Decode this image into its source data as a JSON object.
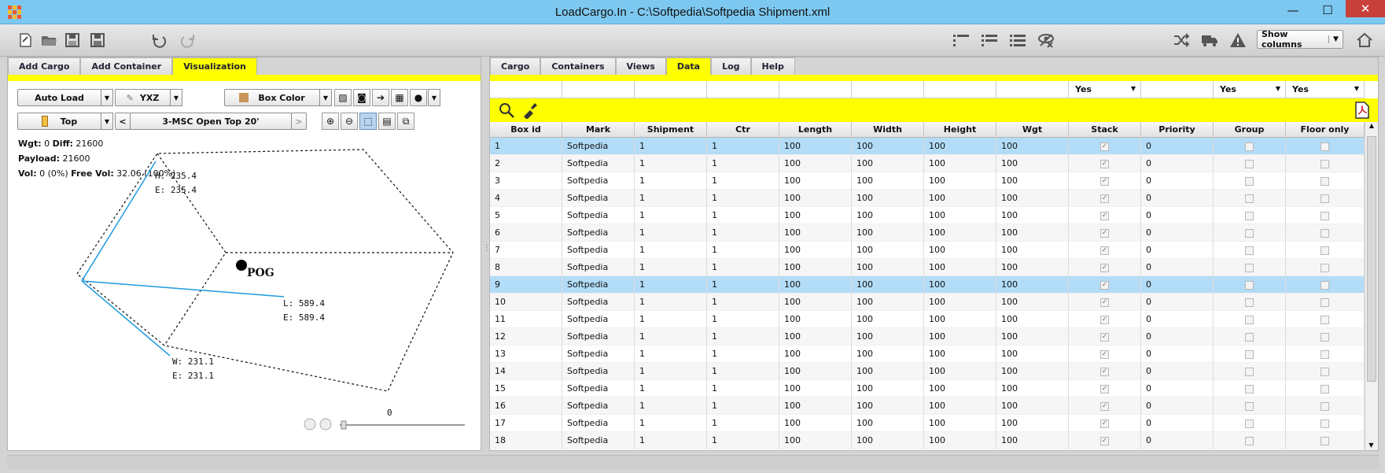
{
  "window": {
    "title": "LoadCargo.In - C:\\Softpedia\\Softpedia Shipment.xml",
    "min": "—",
    "max": "☐",
    "close": "✕"
  },
  "toolbar": {
    "show_columns_label": "Show columns",
    "show_columns_caret": "▼"
  },
  "left": {
    "tabs": [
      {
        "label": "Add Cargo",
        "active": false
      },
      {
        "label": "Add Container",
        "active": false
      },
      {
        "label": "Visualization",
        "active": true
      }
    ],
    "auto_load": "Auto Load",
    "axis_order": "YXZ",
    "box_color": "Box Color",
    "view": "Top",
    "prev": "<",
    "next": ">",
    "container": "3-MSC Open Top 20'",
    "stats": {
      "wgt_label": "Wgt:",
      "wgt": "0",
      "diff_label": "Diff:",
      "diff": "21600",
      "payload_label": "Payload:",
      "payload": "21600",
      "vol_label": "Vol:",
      "vol": "0 (0%)",
      "free_vol_label": "Free Vol:",
      "free_vol": "32.06 (100%)"
    },
    "measures": {
      "h": "H: 235.4",
      "h_e": "E: 235.4",
      "l": "L: 589.4",
      "l_e": "E: 589.4",
      "w": "W: 231.1",
      "w_e": "E: 231.1"
    },
    "pog": "POG",
    "slider_value": "0"
  },
  "right": {
    "tabs": [
      {
        "label": "Cargo",
        "active": false
      },
      {
        "label": "Containers",
        "active": false
      },
      {
        "label": "Views",
        "active": false
      },
      {
        "label": "Data",
        "active": true
      },
      {
        "label": "Log",
        "active": false
      },
      {
        "label": "Help",
        "active": false
      }
    ],
    "filters": [
      "",
      "",
      "",
      "",
      "",
      "",
      "",
      "",
      "Yes",
      "",
      "Yes",
      "Yes"
    ],
    "columns": [
      "Box id",
      "Mark",
      "Shipment",
      "Ctr",
      "Length",
      "Width",
      "Height",
      "Wgt",
      "Stack",
      "Priority",
      "Group",
      "Floor only"
    ],
    "rows": [
      {
        "id": "1",
        "mark": "Softpedia",
        "shipment": "1",
        "ctr": "1",
        "length": "100",
        "width": "100",
        "height": "100",
        "wgt": "100",
        "stack": true,
        "priority": "0",
        "group": false,
        "floor": false
      },
      {
        "id": "2",
        "mark": "Softpedia",
        "shipment": "1",
        "ctr": "1",
        "length": "100",
        "width": "100",
        "height": "100",
        "wgt": "100",
        "stack": true,
        "priority": "0",
        "group": false,
        "floor": false
      },
      {
        "id": "3",
        "mark": "Softpedia",
        "shipment": "1",
        "ctr": "1",
        "length": "100",
        "width": "100",
        "height": "100",
        "wgt": "100",
        "stack": true,
        "priority": "0",
        "group": false,
        "floor": false
      },
      {
        "id": "4",
        "mark": "Softpedia",
        "shipment": "1",
        "ctr": "1",
        "length": "100",
        "width": "100",
        "height": "100",
        "wgt": "100",
        "stack": true,
        "priority": "0",
        "group": false,
        "floor": false
      },
      {
        "id": "5",
        "mark": "Softpedia",
        "shipment": "1",
        "ctr": "1",
        "length": "100",
        "width": "100",
        "height": "100",
        "wgt": "100",
        "stack": true,
        "priority": "0",
        "group": false,
        "floor": false
      },
      {
        "id": "6",
        "mark": "Softpedia",
        "shipment": "1",
        "ctr": "1",
        "length": "100",
        "width": "100",
        "height": "100",
        "wgt": "100",
        "stack": true,
        "priority": "0",
        "group": false,
        "floor": false
      },
      {
        "id": "7",
        "mark": "Softpedia",
        "shipment": "1",
        "ctr": "1",
        "length": "100",
        "width": "100",
        "height": "100",
        "wgt": "100",
        "stack": true,
        "priority": "0",
        "group": false,
        "floor": false
      },
      {
        "id": "8",
        "mark": "Softpedia",
        "shipment": "1",
        "ctr": "1",
        "length": "100",
        "width": "100",
        "height": "100",
        "wgt": "100",
        "stack": true,
        "priority": "0",
        "group": false,
        "floor": false
      },
      {
        "id": "9",
        "mark": "Softpedia",
        "shipment": "1",
        "ctr": "1",
        "length": "100",
        "width": "100",
        "height": "100",
        "wgt": "100",
        "stack": true,
        "priority": "0",
        "group": false,
        "floor": false
      },
      {
        "id": "10",
        "mark": "Softpedia",
        "shipment": "1",
        "ctr": "1",
        "length": "100",
        "width": "100",
        "height": "100",
        "wgt": "100",
        "stack": true,
        "priority": "0",
        "group": false,
        "floor": false
      },
      {
        "id": "11",
        "mark": "Softpedia",
        "shipment": "1",
        "ctr": "1",
        "length": "100",
        "width": "100",
        "height": "100",
        "wgt": "100",
        "stack": true,
        "priority": "0",
        "group": false,
        "floor": false
      },
      {
        "id": "12",
        "mark": "Softpedia",
        "shipment": "1",
        "ctr": "1",
        "length": "100",
        "width": "100",
        "height": "100",
        "wgt": "100",
        "stack": true,
        "priority": "0",
        "group": false,
        "floor": false
      },
      {
        "id": "13",
        "mark": "Softpedia",
        "shipment": "1",
        "ctr": "1",
        "length": "100",
        "width": "100",
        "height": "100",
        "wgt": "100",
        "stack": true,
        "priority": "0",
        "group": false,
        "floor": false
      },
      {
        "id": "14",
        "mark": "Softpedia",
        "shipment": "1",
        "ctr": "1",
        "length": "100",
        "width": "100",
        "height": "100",
        "wgt": "100",
        "stack": true,
        "priority": "0",
        "group": false,
        "floor": false
      },
      {
        "id": "15",
        "mark": "Softpedia",
        "shipment": "1",
        "ctr": "1",
        "length": "100",
        "width": "100",
        "height": "100",
        "wgt": "100",
        "stack": true,
        "priority": "0",
        "group": false,
        "floor": false
      },
      {
        "id": "16",
        "mark": "Softpedia",
        "shipment": "1",
        "ctr": "1",
        "length": "100",
        "width": "100",
        "height": "100",
        "wgt": "100",
        "stack": true,
        "priority": "0",
        "group": false,
        "floor": false
      },
      {
        "id": "17",
        "mark": "Softpedia",
        "shipment": "1",
        "ctr": "1",
        "length": "100",
        "width": "100",
        "height": "100",
        "wgt": "100",
        "stack": true,
        "priority": "0",
        "group": false,
        "floor": false
      },
      {
        "id": "18",
        "mark": "Softpedia",
        "shipment": "1",
        "ctr": "1",
        "length": "100",
        "width": "100",
        "height": "100",
        "wgt": "100",
        "stack": true,
        "priority": "0",
        "group": false,
        "floor": false
      }
    ],
    "selected_rows": [
      "1",
      "9"
    ]
  },
  "colors": {
    "accent_yellow": "#ffff00",
    "selection_blue": "#b2dcf7",
    "titlebar": "#7dc8f0",
    "close_red": "#c7403a",
    "dimension_line": "#1e9be0"
  },
  "icons": {
    "toolbar_left": [
      "new-document-icon",
      "open-folder-icon",
      "save-icon",
      "save-as-icon",
      "undo-icon",
      "redo-icon"
    ],
    "toolbar_right": [
      "list-compact-icon",
      "list-icon",
      "list-detail-icon",
      "hide-view-icon",
      "shuffle-icon",
      "truck-icon",
      "warning-icon",
      "home-icon"
    ]
  }
}
